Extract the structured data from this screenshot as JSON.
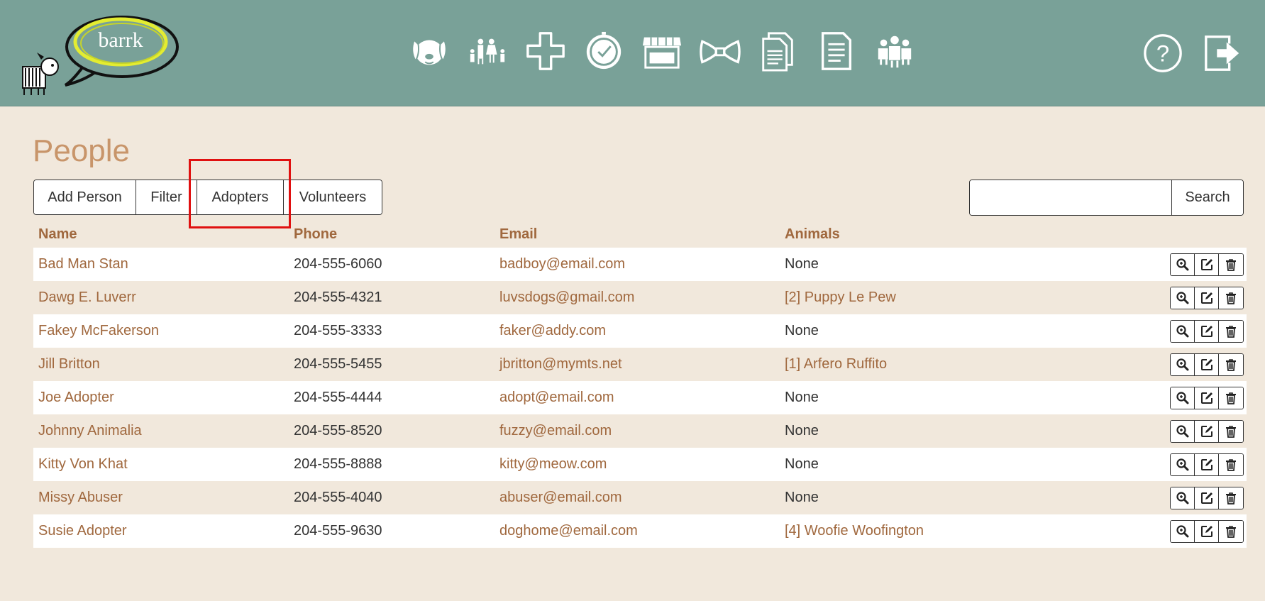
{
  "app": {
    "logo_text": "barrk"
  },
  "nav": {
    "items": [
      {
        "icon": "dog-face-icon"
      },
      {
        "icon": "family-icon"
      },
      {
        "icon": "medical-cross-icon"
      },
      {
        "icon": "clock-icon"
      },
      {
        "icon": "store-icon"
      },
      {
        "icon": "bow-tie-icon"
      },
      {
        "icon": "documents-icon"
      },
      {
        "icon": "document-icon"
      },
      {
        "icon": "group-icon"
      }
    ],
    "help_icon": "help-icon",
    "logout_icon": "logout-icon"
  },
  "page": {
    "title": "People"
  },
  "toolbar": {
    "add_person": "Add Person",
    "filter": "Filter",
    "adopters": "Adopters",
    "volunteers": "Volunteers",
    "search_value": "",
    "search_label": "Search"
  },
  "table": {
    "headers": {
      "name": "Name",
      "phone": "Phone",
      "email": "Email",
      "animals": "Animals"
    },
    "rows": [
      {
        "name": "Bad Man Stan",
        "phone": "204-555-6060",
        "email": "badboy@email.com",
        "animals": "None"
      },
      {
        "name": "Dawg E. Luverr",
        "phone": "204-555-4321",
        "email": "luvsdogs@gmail.com",
        "animals": "[2] Puppy Le Pew"
      },
      {
        "name": "Fakey McFakerson",
        "phone": "204-555-3333",
        "email": "faker@addy.com",
        "animals": "None"
      },
      {
        "name": "Jill Britton",
        "phone": "204-555-5455",
        "email": "jbritton@mymts.net",
        "animals": "[1] Arfero Ruffito"
      },
      {
        "name": "Joe Adopter",
        "phone": "204-555-4444",
        "email": "adopt@email.com",
        "animals": "None"
      },
      {
        "name": "Johnny Animalia",
        "phone": "204-555-8520",
        "email": "fuzzy@email.com",
        "animals": "None"
      },
      {
        "name": "Kitty Von Khat",
        "phone": "204-555-8888",
        "email": "kitty@meow.com",
        "animals": "None"
      },
      {
        "name": "Missy Abuser",
        "phone": "204-555-4040",
        "email": "abuser@email.com",
        "animals": "None"
      },
      {
        "name": "Susie Adopter",
        "phone": "204-555-9630",
        "email": "doghome@email.com",
        "animals": "[4] Woofie Woofington"
      }
    ]
  },
  "colors": {
    "header_bg": "#79a198",
    "page_bg": "#f1e8dc",
    "accent": "#c8956a",
    "link": "#a0683e",
    "highlight": "#e01010"
  }
}
